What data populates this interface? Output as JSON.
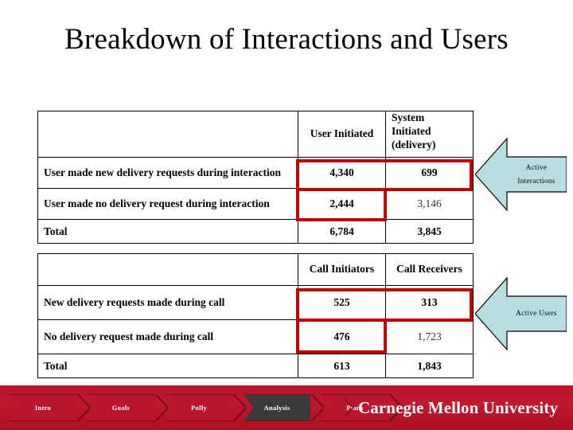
{
  "slide": {
    "title": "Breakdown of Interactions and Users",
    "background_color": "#ffffff"
  },
  "colors": {
    "highlight_fill": "#cdcdeb",
    "highlight_outline": "#c00000",
    "header_fill": "#f0f0f0",
    "arrow_fill": "#b8dde0",
    "brand_crimson": "#c4162f",
    "active_tab": "#3a3a3a"
  },
  "tables": [
    {
      "id": "interactions",
      "columns": [
        "",
        "User Initiated",
        "System Initiated (delivery)"
      ],
      "column_lines": [
        [
          ""
        ],
        [
          "User Initiated"
        ],
        [
          "System",
          "Initiated",
          "(delivery)"
        ]
      ],
      "rows": [
        {
          "label": "User made new delivery requests during interaction",
          "values": [
            "4,340",
            "699"
          ],
          "highlighted": [
            true,
            true
          ]
        },
        {
          "label": "User made no delivery request during interaction",
          "values": [
            "2,444",
            "3,146"
          ],
          "highlighted": [
            true,
            false
          ]
        },
        {
          "label": "Total",
          "values": [
            "6,784",
            "3,845"
          ],
          "highlighted": [
            false,
            false
          ]
        }
      ]
    },
    {
      "id": "users",
      "columns": [
        "",
        "Call Initiators",
        "Call Receivers"
      ],
      "column_lines": [
        [
          ""
        ],
        [
          "Call Initiators"
        ],
        [
          "Call Receivers"
        ]
      ],
      "rows": [
        {
          "label": "New delivery requests made during call",
          "values": [
            "525",
            "313"
          ],
          "highlighted": [
            true,
            true
          ]
        },
        {
          "label": "No delivery request made during call",
          "values": [
            "476",
            "1,723"
          ],
          "highlighted": [
            true,
            false
          ]
        },
        {
          "label": "Total",
          "values": [
            "613",
            "1,843"
          ],
          "highlighted": [
            false,
            false
          ]
        }
      ]
    }
  ],
  "callouts": [
    {
      "id": "active-interactions",
      "line1": "Active",
      "line2": "Interactions",
      "icon": "left-arrow-icon"
    },
    {
      "id": "active-users",
      "line1": "Active Users",
      "line2": "",
      "icon": "left-arrow-icon"
    }
  ],
  "footer": {
    "nav_items": [
      {
        "label": "Intro",
        "active": false
      },
      {
        "label": "Goals",
        "active": false
      },
      {
        "label": "Polly",
        "active": false
      },
      {
        "label": "Analysis",
        "active": true
      },
      {
        "label": "Plans",
        "active": false
      }
    ],
    "wordmark": "Carnegie Mellon University"
  }
}
